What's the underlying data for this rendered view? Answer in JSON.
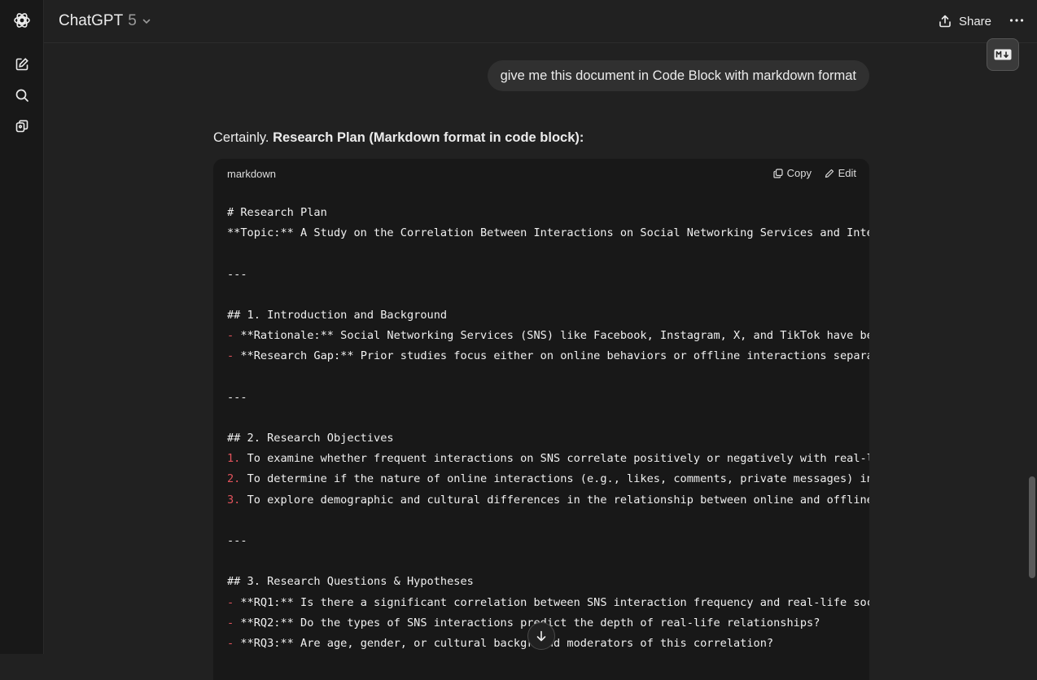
{
  "header": {
    "model_name": "ChatGPT",
    "model_version": "5",
    "share_label": "Share"
  },
  "rail": {
    "icons": [
      "chatgpt-logo-icon",
      "new-chat-icon",
      "search-icon",
      "library-icon"
    ]
  },
  "conversation": {
    "user_message": "give me this document in Code Block with markdown format",
    "assistant_intro_plain": "Certainly. ",
    "assistant_intro_bold": "Research Plan (Markdown format in code block):"
  },
  "code_block": {
    "language": "markdown",
    "copy_label": "Copy",
    "edit_label": "Edit",
    "lines": [
      {
        "marker": "",
        "text": "# Research Plan"
      },
      {
        "marker": "",
        "text": "**Topic:** A Study on the Correlation Between Interactions on Social Networking Services and Inter"
      },
      {
        "marker": "",
        "text": ""
      },
      {
        "marker": "",
        "text": "---"
      },
      {
        "marker": "",
        "text": ""
      },
      {
        "marker": "",
        "text": "## 1. Introduction and Background"
      },
      {
        "marker": "- ",
        "text": "**Rationale:** Social Networking Services (SNS) like Facebook, Instagram, X, and TikTok have bec"
      },
      {
        "marker": "- ",
        "text": "**Research Gap:** Prior studies focus either on online behaviors or offline interactions separat"
      },
      {
        "marker": "",
        "text": ""
      },
      {
        "marker": "",
        "text": "---"
      },
      {
        "marker": "",
        "text": ""
      },
      {
        "marker": "",
        "text": "## 2. Research Objectives"
      },
      {
        "marker": "1. ",
        "text": "To examine whether frequent interactions on SNS correlate positively or negatively with real-li"
      },
      {
        "marker": "2. ",
        "text": "To determine if the nature of online interactions (e.g., likes, comments, private messages) inf"
      },
      {
        "marker": "3. ",
        "text": "To explore demographic and cultural differences in the relationship between online and offline "
      },
      {
        "marker": "",
        "text": ""
      },
      {
        "marker": "",
        "text": "---"
      },
      {
        "marker": "",
        "text": ""
      },
      {
        "marker": "",
        "text": "## 3. Research Questions & Hypotheses"
      },
      {
        "marker": "- ",
        "text": "**RQ1:** Is there a significant correlation between SNS interaction frequency and real-life soci"
      },
      {
        "marker": "- ",
        "text": "**RQ2:** Do the types of SNS interactions predict the depth of real-life relationships?"
      },
      {
        "marker": "- ",
        "text": "**RQ3:** Are age, gender, or cultural background moderators of this correlation?"
      }
    ]
  }
}
